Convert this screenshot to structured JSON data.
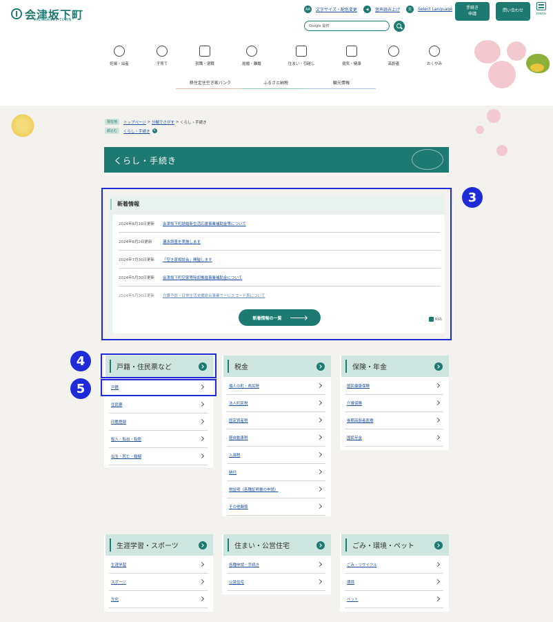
{
  "header": {
    "logo_text": "会津坂下町",
    "logo_sub": "AIZUBANGE TOWN",
    "utils": [
      {
        "icon": "text-size-icon",
        "glyph": "AA",
        "label": "文字サイズ・配色変更"
      },
      {
        "icon": "speaker-icon",
        "glyph": "◀",
        "label": "音声読み上げ"
      },
      {
        "icon": "language-icon",
        "glyph": "文",
        "label": "Select Language"
      }
    ],
    "tetsuzuki_button": "手続き\n申請",
    "contact_button": "問い合わせ",
    "menu_label": "menu",
    "search_placeholder": "Google 提供"
  },
  "global_nav": [
    {
      "label": "妊娠・出産",
      "icon": "pregnancy-icon"
    },
    {
      "label": "子育て",
      "icon": "child-icon"
    },
    {
      "label": "就職・退職",
      "icon": "briefcase-icon"
    },
    {
      "label": "結婚・離婚",
      "icon": "rings-icon"
    },
    {
      "label": "住まい・引越し",
      "icon": "house-icon"
    },
    {
      "label": "病気・健康",
      "icon": "medical-icon"
    },
    {
      "label": "高齢者",
      "icon": "elderly-icon"
    },
    {
      "label": "おくやみ",
      "icon": "flower-icon"
    }
  ],
  "sub_nav": [
    "移住定住空き家バンク",
    "ふるさと納税",
    "観光情報"
  ],
  "breadcrumb": {
    "current_label": "現在地",
    "top": "トップページ",
    "category": "分類でさがす",
    "current": "くらし・手続き",
    "filter_label": "絞込む",
    "filter_value": "くらし・手続き"
  },
  "page_title": "くらし・手続き",
  "news": {
    "title": "新着情報",
    "items": [
      {
        "date": "2024年8月16日更新",
        "title": "会津坂下町結婚新生活応援事業補助金等について"
      },
      {
        "date": "2024年8月2日更新",
        "title": "漏水調査を実施します"
      },
      {
        "date": "2024年7月30日更新",
        "title": "「空き家相談会」開催します"
      },
      {
        "date": "2024年5月30日更新",
        "title": "会津坂下町空家等除却推進事業補助金について"
      },
      {
        "date": "2024年5月30日更新",
        "title": "介護予防・日常生活支援総合事業サービスコード表について"
      }
    ],
    "more_button": "新着情報の一覧",
    "rss": "RSS"
  },
  "markers": {
    "m3": "3",
    "m4": "4",
    "m5": "5"
  },
  "cards": [
    {
      "title": "戸籍・住民票など",
      "items": [
        "戸籍",
        "住民票",
        "印鑑登録",
        "転入・転出・転居",
        "出生・死亡・婚姻"
      ]
    },
    {
      "title": "税金",
      "items": [
        "個人の町・県民税",
        "法人町民税",
        "固定資産税",
        "軽自動車税",
        "入湯税",
        "納付",
        "税証明（各種証明書の申請）",
        "その他関係"
      ]
    },
    {
      "title": "保険・年金",
      "items": [
        "国民健康保険",
        "介護保険",
        "後期高齢者医療",
        "国民年金"
      ]
    },
    {
      "title": "生涯学習・スポーツ",
      "items": [
        "生涯学習",
        "スポーツ",
        "文化"
      ]
    },
    {
      "title": "住まい・公営住宅",
      "items": [
        "各種申請・手続き",
        "公営住宅"
      ]
    },
    {
      "title": "ごみ・環境・ペット",
      "items": [
        "ごみ・リサイクル",
        "環境",
        "ペット"
      ]
    }
  ],
  "colors": {
    "accent": "#1d7a70",
    "highlight": "#1e2bd9",
    "card_header": "#cfe5df"
  }
}
